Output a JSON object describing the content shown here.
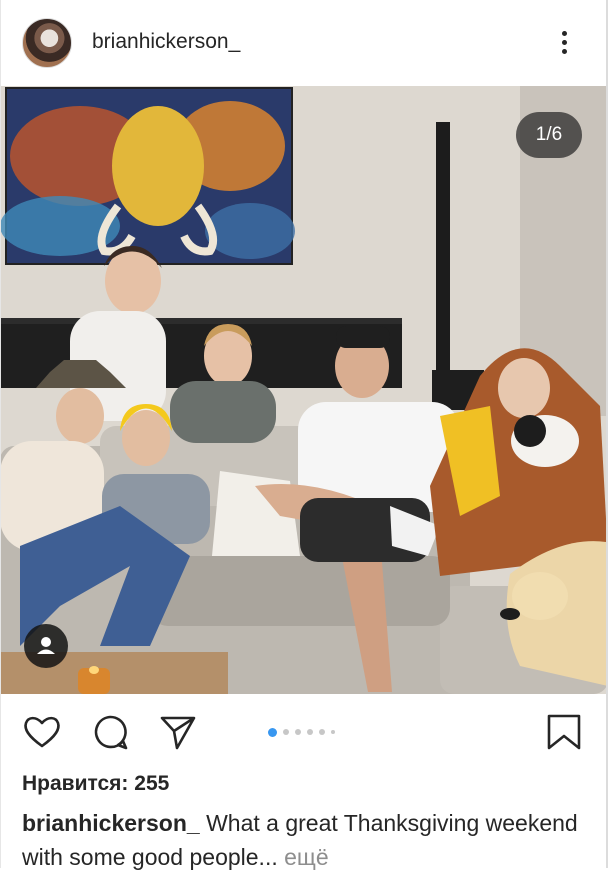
{
  "post": {
    "username": "brianhickerson_",
    "image_counter": "1/6",
    "likes_label": "Нравится: 255",
    "caption_user": "brianhickerson_",
    "caption_text": " What a great Thanksgiving weekend with some good people... ",
    "caption_more": "ещё"
  },
  "icons": {
    "options": "more-vertical-icon",
    "like": "heart-outline-icon",
    "comment": "comment-bubble-icon",
    "share": "paper-plane-icon",
    "save": "bookmark-outline-icon",
    "user_tag": "person-icon"
  },
  "carousel": {
    "count": 6,
    "active_index": 0
  },
  "colors": {
    "accent": "#3897f0",
    "text": "#262626",
    "muted": "#8e8e8e"
  }
}
